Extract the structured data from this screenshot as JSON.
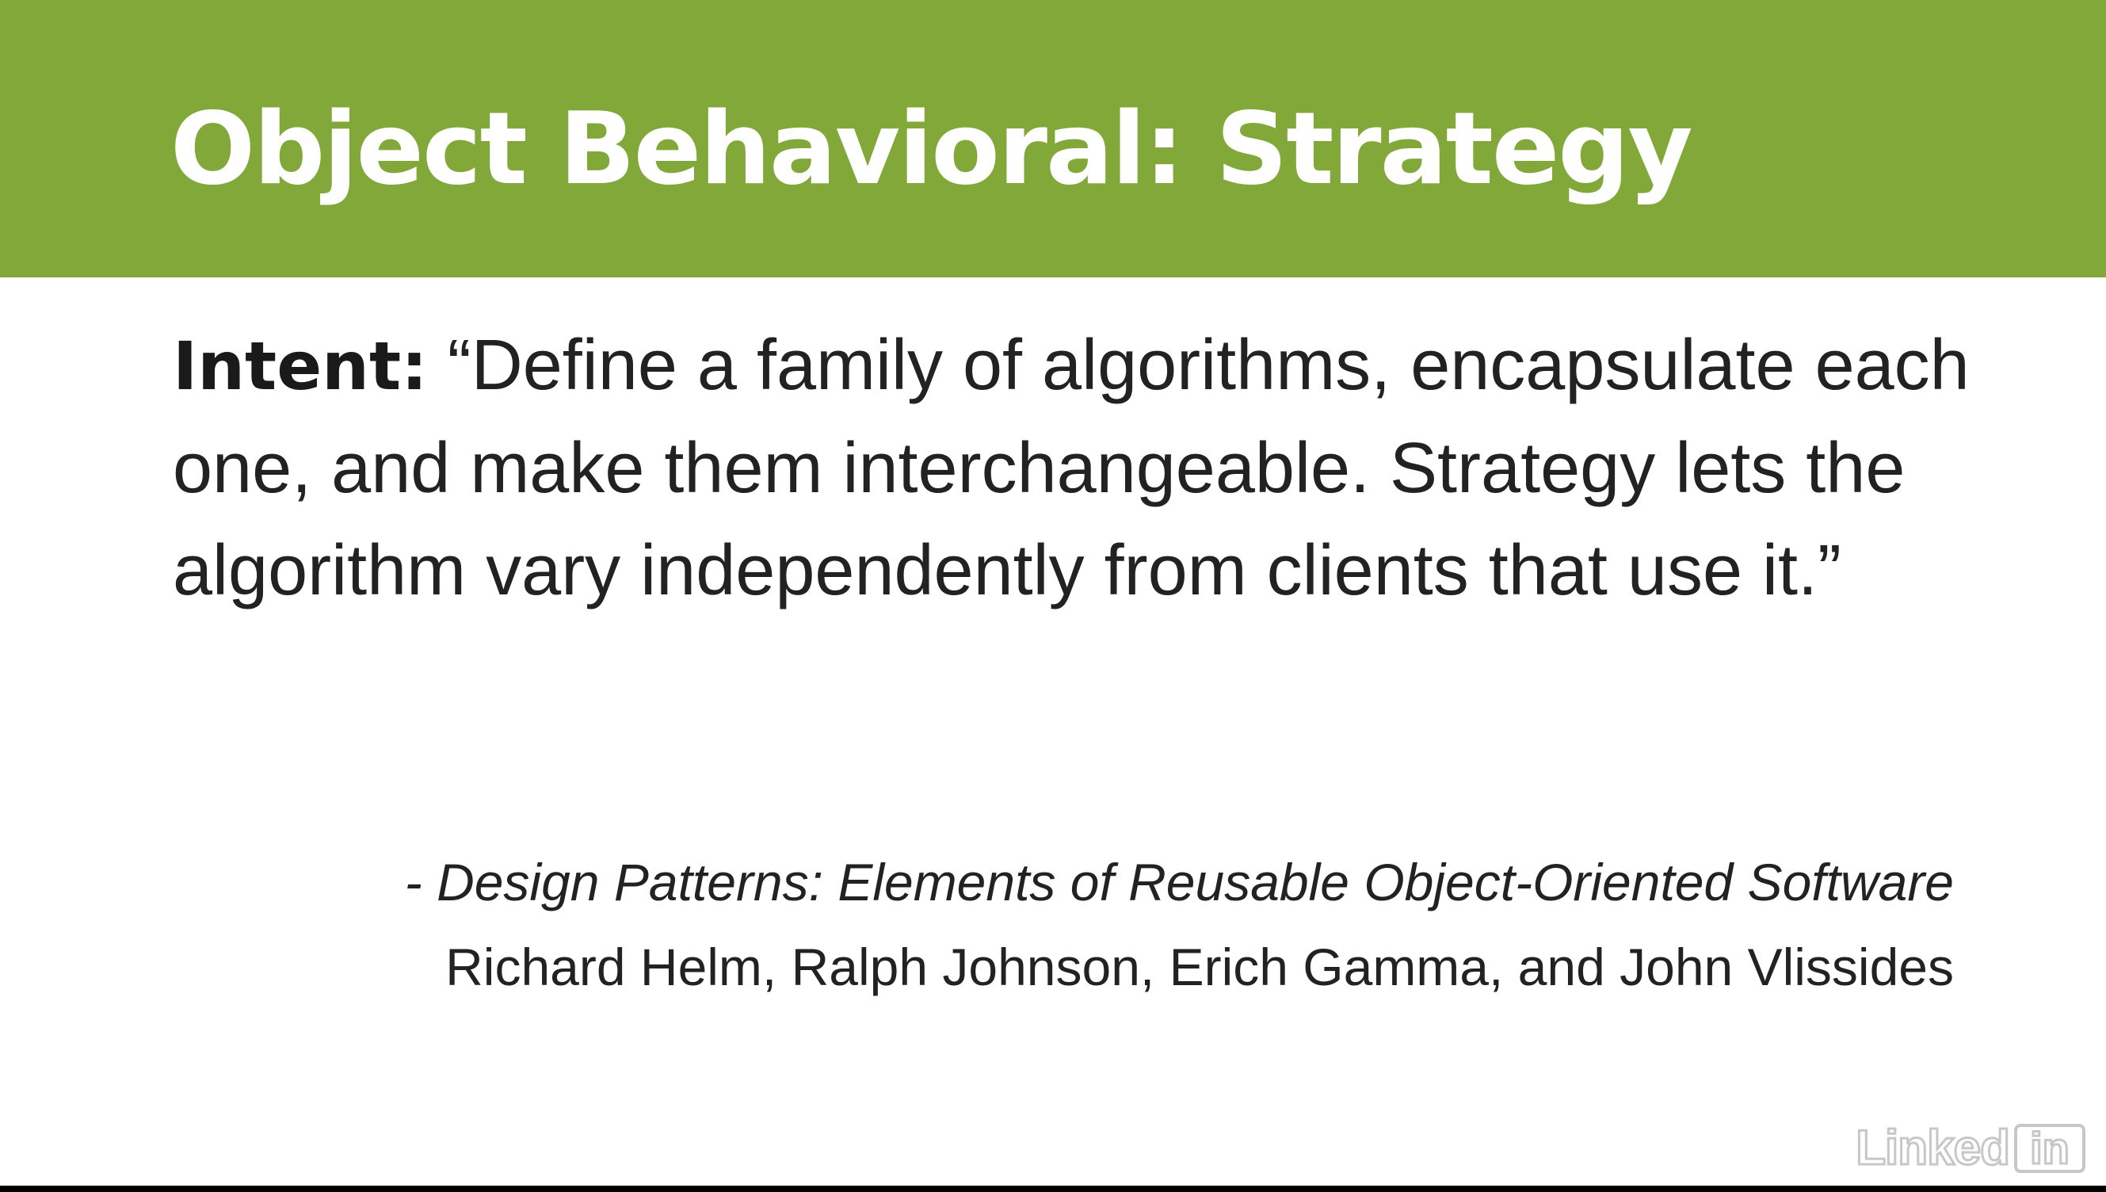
{
  "slide": {
    "title": "Object Behavioral: Strategy",
    "intent_label": "Intent:",
    "intent_text": "“Define a family of algorithms, encapsulate each one, and make them interchangeable. Strategy lets the algorithm vary independently from clients that use it.”",
    "citation_book": "- Design Patterns: Elements of Reusable Object-Oriented Software",
    "citation_authors": "Richard Helm, Ralph Johnson, Erich Gamma, and John Vlissides"
  },
  "watermark": {
    "word": "Linked",
    "box": "in"
  },
  "colors": {
    "title_bar": "#82a83a",
    "title_text": "#ffffff",
    "body_text": "#222222"
  }
}
